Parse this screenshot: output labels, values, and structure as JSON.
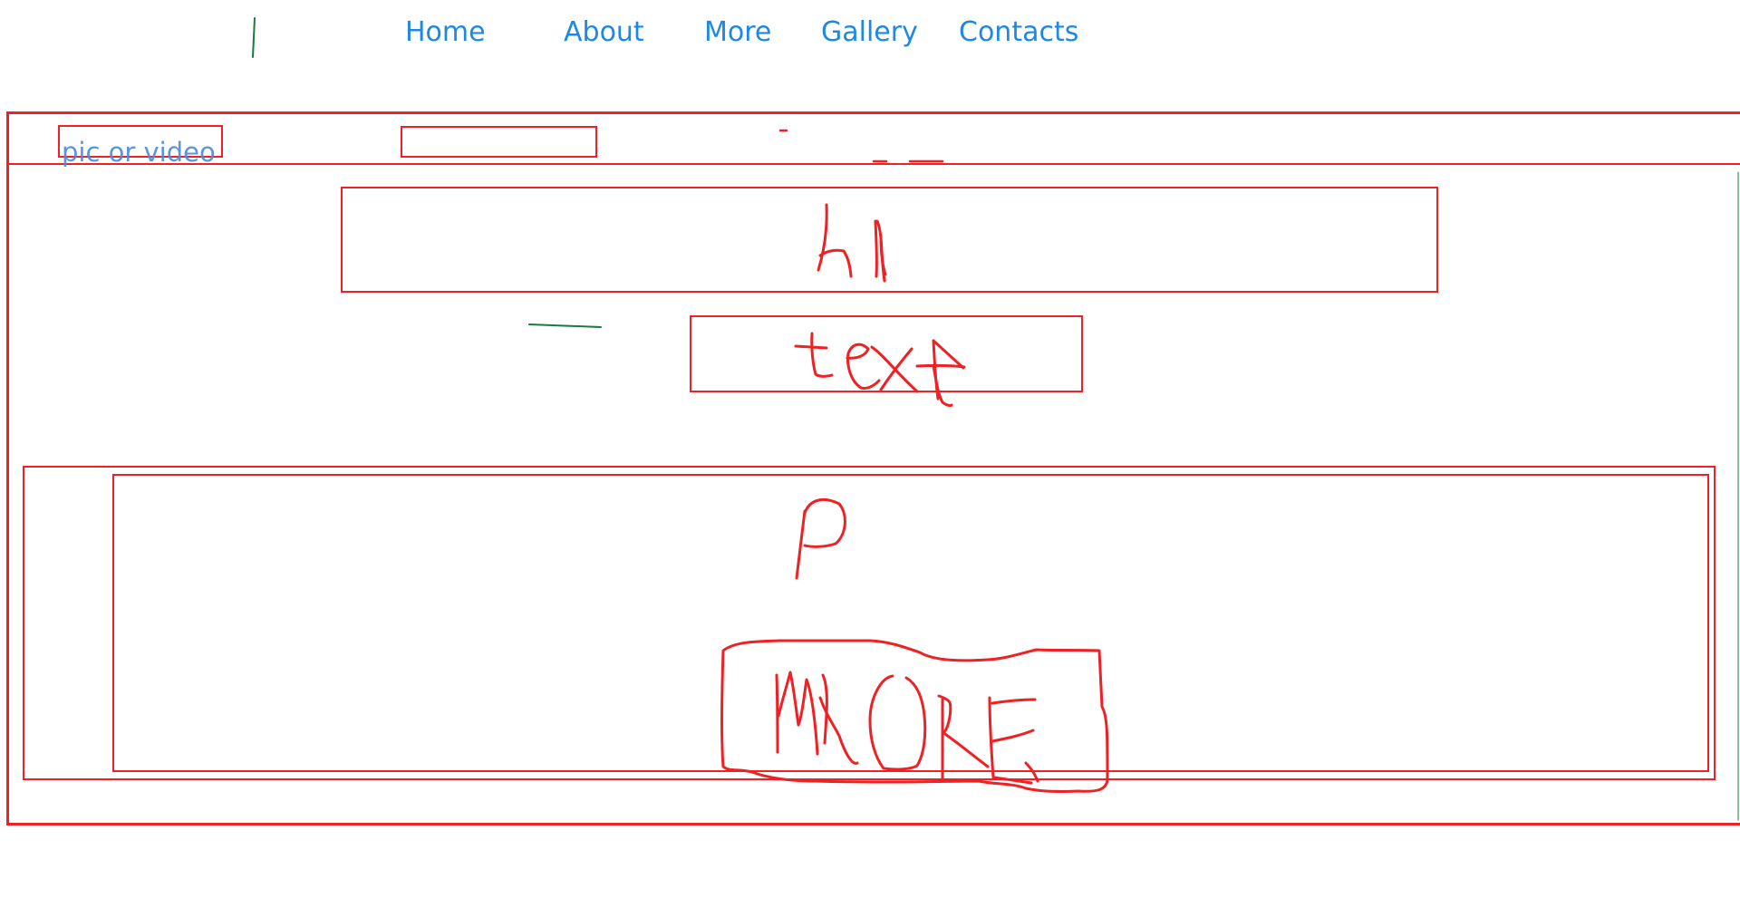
{
  "nav": {
    "items": [
      {
        "label": "Home"
      },
      {
        "label": "About"
      },
      {
        "label": "More"
      },
      {
        "label": "Gallery"
      },
      {
        "label": "Contacts"
      }
    ]
  },
  "header_strip": {
    "pic_label": "pic or video"
  },
  "hero": {
    "heading_sketch": "h1",
    "text_sketch": "text"
  },
  "content": {
    "paragraph_sketch": "p",
    "button_sketch": "MORE"
  },
  "colors": {
    "nav_link": "#1e88e5",
    "outline": "#ee2124",
    "annotation": "#1a7a3c"
  }
}
